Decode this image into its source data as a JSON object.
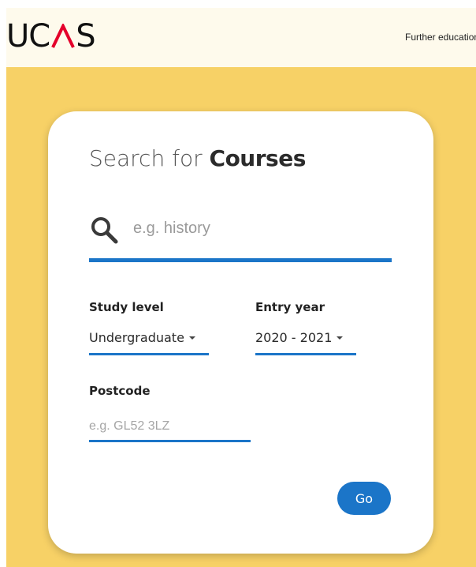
{
  "header": {
    "logo_left": "UC",
    "logo_right": "S",
    "nav_link": "Further education"
  },
  "search_card": {
    "heading_prefix": "Search for",
    "heading_strong": "Courses",
    "search_placeholder": "e.g. history",
    "study_level": {
      "label": "Study level",
      "selected": "Undergraduate"
    },
    "entry_year": {
      "label": "Entry year",
      "selected": "2020 - 2021"
    },
    "postcode": {
      "label": "Postcode",
      "placeholder": "e.g. GL52 3LZ"
    },
    "go_label": "Go"
  },
  "icons": {
    "search": "search-icon",
    "dropdown": "caret-down-icon"
  },
  "colors": {
    "accent_blue": "#1b75c8",
    "banner_yellow": "#f7d166",
    "header_cream": "#fefaec",
    "logo_red": "#e4002b"
  }
}
